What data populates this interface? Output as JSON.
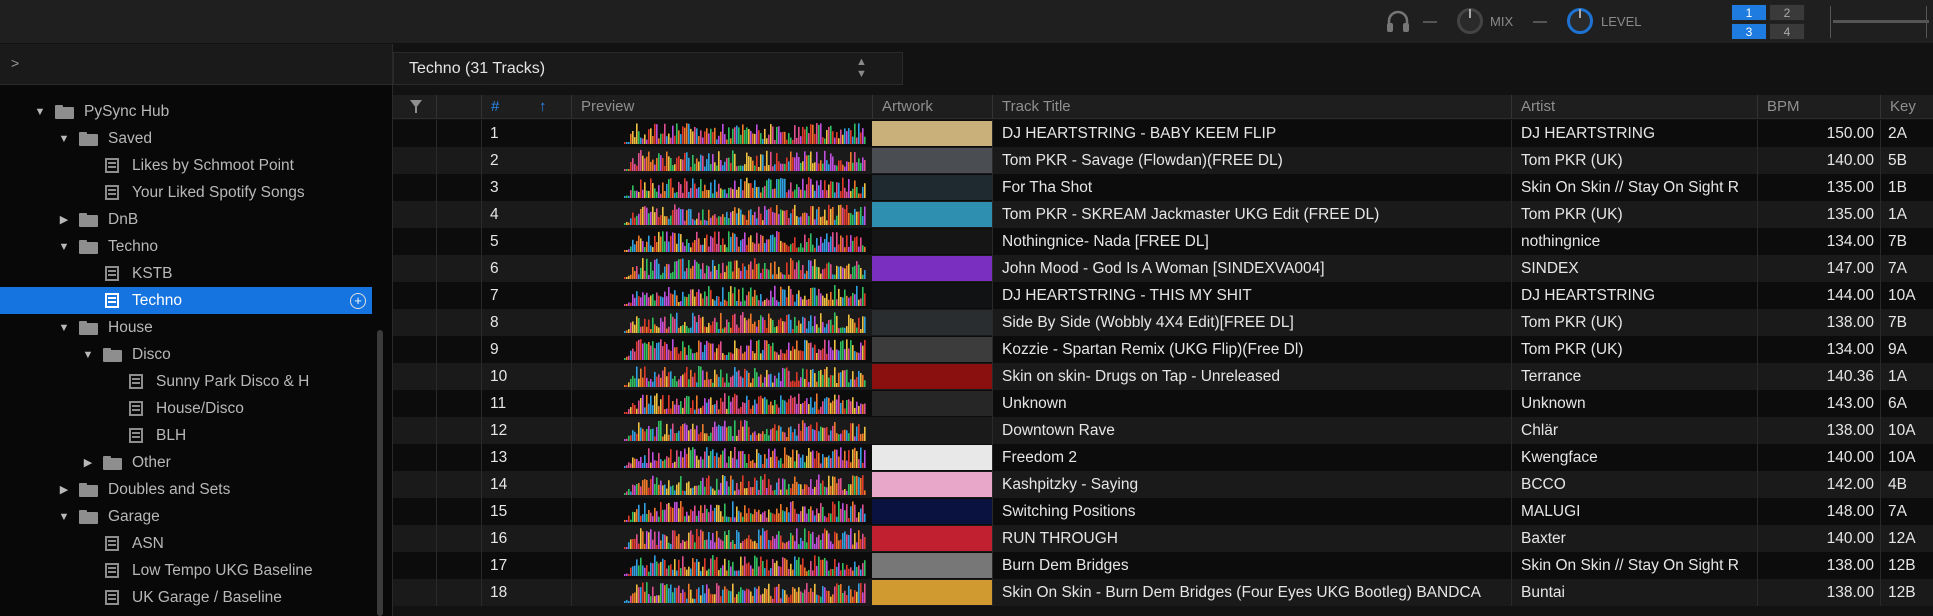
{
  "topbar": {
    "mix_label": "MIX",
    "level_label": "LEVEL",
    "deck_buttons": [
      "1",
      "2",
      "3",
      "4"
    ],
    "active_decks": [
      "1",
      "3"
    ]
  },
  "sidebar": {
    "items": [
      {
        "label": "PySync Hub",
        "type": "folder",
        "expanded": true
      },
      {
        "label": "Saved",
        "type": "folder",
        "expanded": true
      },
      {
        "label": "Likes by Schmoot Point",
        "type": "playlist"
      },
      {
        "label": "Your Liked Spotify Songs",
        "type": "playlist"
      },
      {
        "label": "DnB",
        "type": "folder",
        "expanded": false
      },
      {
        "label": "Techno",
        "type": "folder",
        "expanded": true
      },
      {
        "label": "KSTB",
        "type": "playlist"
      },
      {
        "label": "Techno",
        "type": "playlist",
        "selected": true
      },
      {
        "label": "House",
        "type": "folder",
        "expanded": true
      },
      {
        "label": "Disco",
        "type": "folder",
        "expanded": true
      },
      {
        "label": "Sunny Park Disco & H",
        "type": "playlist"
      },
      {
        "label": "House/Disco",
        "type": "playlist"
      },
      {
        "label": "BLH",
        "type": "playlist"
      },
      {
        "label": "Other",
        "type": "folder",
        "expanded": false
      },
      {
        "label": "Doubles and Sets",
        "type": "folder",
        "expanded": false
      },
      {
        "label": "Garage",
        "type": "folder",
        "expanded": true
      },
      {
        "label": "ASN",
        "type": "playlist"
      },
      {
        "label": "Low Tempo UKG Baseline",
        "type": "playlist"
      },
      {
        "label": "UK Garage / Baseline",
        "type": "playlist"
      }
    ]
  },
  "tracklist": {
    "title": "Techno (31 Tracks)",
    "columns": {
      "num": "#",
      "preview": "Preview",
      "artwork": "Artwork",
      "title": "Track Title",
      "artist": "Artist",
      "bpm": "BPM",
      "key": "Key"
    },
    "rows": [
      {
        "num": "1",
        "title": "DJ HEARTSTRING - BABY KEEM FLIP",
        "artist": "DJ HEARTSTRING",
        "bpm": "150.00",
        "key": "2A",
        "art_color": "#c9b07a"
      },
      {
        "num": "2",
        "title": "Tom PKR - Savage (Flowdan)(FREE DL)",
        "artist": "Tom PKR (UK)",
        "bpm": "140.00",
        "key": "5B",
        "art_color": "#4a4e52"
      },
      {
        "num": "3",
        "title": "For Tha Shot",
        "artist": "Skin On Skin // Stay On Sight R",
        "bpm": "135.00",
        "key": "1B",
        "art_color": "#1f2a30"
      },
      {
        "num": "4",
        "title": "Tom PKR - SKREAM Jackmaster UKG Edit (FREE DL)",
        "artist": "Tom PKR (UK)",
        "bpm": "135.00",
        "key": "1A",
        "art_color": "#2f8fb0"
      },
      {
        "num": "5",
        "title": "Nothingnice- Nada [FREE DL]",
        "artist": "nothingnice",
        "bpm": "134.00",
        "key": "7B",
        "art_color": "#151515"
      },
      {
        "num": "6",
        "title": "John Mood - God Is A Woman [SINDEXVA004]",
        "artist": "SINDEX",
        "bpm": "147.00",
        "key": "7A",
        "art_color": "#7b2fc0"
      },
      {
        "num": "7",
        "title": "DJ HEARTSTRING - THIS MY SHIT",
        "artist": "DJ HEARTSTRING",
        "bpm": "144.00",
        "key": "10A",
        "art_color": "#101214"
      },
      {
        "num": "8",
        "title": "Side By Side (Wobbly 4X4 Edit)[FREE DL]",
        "artist": "Tom PKR (UK)",
        "bpm": "138.00",
        "key": "7B",
        "art_color": "#2a2d30"
      },
      {
        "num": "9",
        "title": "Kozzie - Spartan Remix (UKG Flip)(Free Dl)",
        "artist": "Tom PKR (UK)",
        "bpm": "134.00",
        "key": "9A",
        "art_color": "#3c3c3c"
      },
      {
        "num": "10",
        "title": "Skin on skin- Drugs on Tap - Unreleased",
        "artist": "Terrance",
        "bpm": "140.36",
        "key": "1A",
        "art_color": "#8a1010"
      },
      {
        "num": "11",
        "title": "Unknown",
        "artist": "Unknown",
        "bpm": "143.00",
        "key": "6A",
        "art_color": "#262626"
      },
      {
        "num": "12",
        "title": "Downtown Rave",
        "artist": "Chlär",
        "bpm": "138.00",
        "key": "10A",
        "art_color": "#1a1a1a"
      },
      {
        "num": "13",
        "title": "Freedom 2",
        "artist": "Kwengface",
        "bpm": "140.00",
        "key": "10A",
        "art_color": "#e8e8e8"
      },
      {
        "num": "14",
        "title": "Kashpitzky - Saying",
        "artist": "BCCO",
        "bpm": "142.00",
        "key": "4B",
        "art_color": "#e8a6c8"
      },
      {
        "num": "15",
        "title": "Switching Positions",
        "artist": "MALUGI",
        "bpm": "148.00",
        "key": "7A",
        "art_color": "#0a1240"
      },
      {
        "num": "16",
        "title": "RUN THROUGH",
        "artist": "Baxter",
        "bpm": "140.00",
        "key": "12A",
        "art_color": "#c02030"
      },
      {
        "num": "17",
        "title": "Burn Dem Bridges",
        "artist": "Skin On Skin // Stay On Sight R",
        "bpm": "138.00",
        "key": "12B",
        "art_color": "#777777"
      },
      {
        "num": "18",
        "title": "Skin On Skin - Burn Dem Bridges (Four Eyes UKG Bootleg) BANDCA",
        "artist": "Buntai",
        "bpm": "138.00",
        "key": "12B",
        "art_color": "#d09a30"
      }
    ]
  },
  "colors": {
    "accent": "#1574e0",
    "row_odd": "#0c0c0c",
    "row_even": "#1a1a1a"
  }
}
